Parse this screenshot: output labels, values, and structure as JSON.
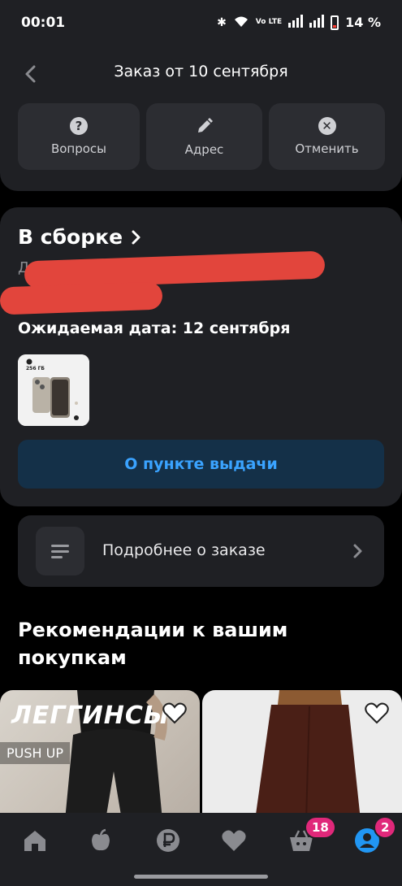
{
  "status_bar": {
    "time": "00:01",
    "network": "Vo LTE",
    "battery": "14 %"
  },
  "header": {
    "title": "Заказ от 10 сентября",
    "actions": [
      {
        "label": "Вопросы",
        "icon": "question-icon"
      },
      {
        "label": "Адрес",
        "icon": "pencil-icon"
      },
      {
        "label": "Отменить",
        "icon": "close-icon"
      }
    ]
  },
  "order_status": {
    "title": "В сборке",
    "delivery_prefix": "Дост",
    "expected_date": "Ожидаемая дата: 12 сентября",
    "product_storage_label": "256 ГБ",
    "pickup_button": "О пункте выдачи"
  },
  "details": {
    "label": "Подробнее о заказе"
  },
  "recommendations": {
    "title": "Рекомендации к вашим покупкам",
    "items": [
      {
        "headline": "ЛЕГГИНСЫ",
        "badge": "PUSH UP"
      },
      {
        "headline": "",
        "badge": ""
      }
    ]
  },
  "bottom_nav": {
    "cart_badge": "18",
    "profile_badge": "2"
  },
  "colors": {
    "accent": "#3aa3ff",
    "badge": "#e0287a",
    "redaction": "#e2453c"
  }
}
